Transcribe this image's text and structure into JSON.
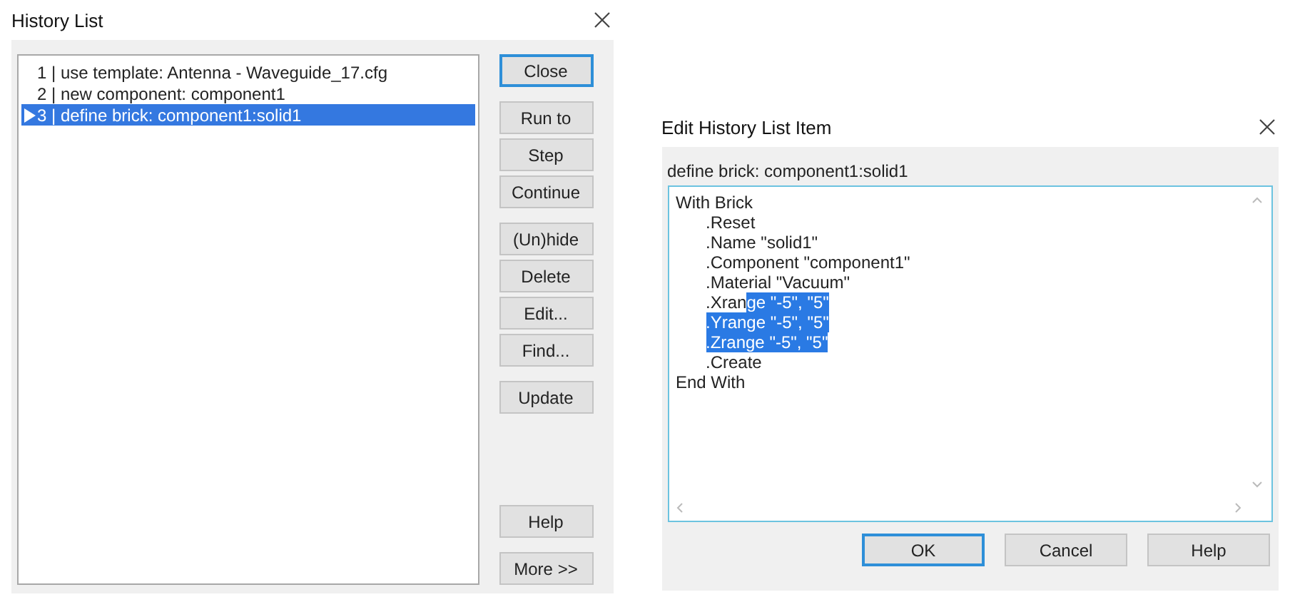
{
  "history_dialog": {
    "title": "History List",
    "items": [
      {
        "text": "1 | use template: Antenna - Waveguide_17.cfg",
        "selected": false,
        "current": false
      },
      {
        "text": "2 | new component: component1",
        "selected": false,
        "current": false
      },
      {
        "text": "3 | define brick: component1:solid1",
        "selected": true,
        "current": true
      }
    ],
    "button_groups": [
      [
        {
          "label": "Close",
          "default": true
        }
      ],
      [
        {
          "label": "Run to",
          "default": false
        },
        {
          "label": "Step",
          "default": false
        },
        {
          "label": "Continue",
          "default": false
        }
      ],
      [
        {
          "label": "(Un)hide",
          "default": false
        },
        {
          "label": "Delete",
          "default": false
        },
        {
          "label": "Edit...",
          "default": false
        },
        {
          "label": "Find...",
          "default": false
        }
      ],
      [
        {
          "label": "Update",
          "default": false
        }
      ]
    ],
    "bottom_buttons": [
      {
        "label": "Help",
        "default": false
      },
      {
        "label": "More >>",
        "default": false
      }
    ]
  },
  "edit_dialog": {
    "title": "Edit History List Item",
    "caption": "define brick: component1:solid1",
    "code": [
      {
        "segments": [
          {
            "text": "With Brick",
            "selected": false
          }
        ],
        "children": [
          {
            "segments": [
              {
                "text": ".Reset",
                "selected": false
              }
            ]
          },
          {
            "segments": [
              {
                "text": ".Name \"solid1\"",
                "selected": false
              }
            ]
          },
          {
            "segments": [
              {
                "text": ".Component \"component1\"",
                "selected": false
              }
            ]
          },
          {
            "segments": [
              {
                "text": ".Material \"Vacuum\"",
                "selected": false
              }
            ]
          },
          {
            "segments": [
              {
                "text": ".Xran",
                "selected": false
              },
              {
                "text": "ge \"-5\", \"5\"",
                "selected": true
              }
            ]
          },
          {
            "segments": [
              {
                "text": ".Yrange \"-5\", \"5\"",
                "selected": true
              }
            ]
          },
          {
            "segments": [
              {
                "text": ".Zrange \"-5\", \"5\"",
                "selected": true
              }
            ]
          },
          {
            "segments": [
              {
                "text": ".Create",
                "selected": false
              }
            ]
          }
        ]
      },
      {
        "segments": [
          {
            "text": "End With",
            "selected": false
          }
        ]
      }
    ],
    "buttons": [
      {
        "label": "OK",
        "default": true
      },
      {
        "label": "Cancel",
        "default": false
      },
      {
        "label": "Help",
        "default": false
      }
    ]
  }
}
